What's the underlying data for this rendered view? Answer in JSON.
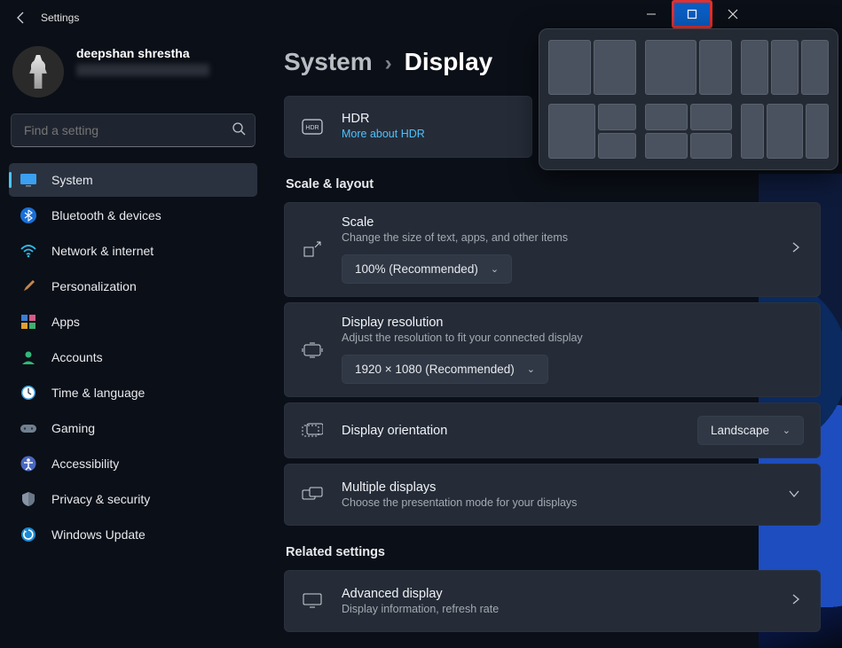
{
  "titlebar": {
    "app_title": "Settings"
  },
  "profile": {
    "name": "deepshan shrestha"
  },
  "search": {
    "placeholder": "Find a setting"
  },
  "nav": {
    "items": [
      {
        "label": "System",
        "icon": "system"
      },
      {
        "label": "Bluetooth & devices",
        "icon": "bluetooth"
      },
      {
        "label": "Network & internet",
        "icon": "wifi"
      },
      {
        "label": "Personalization",
        "icon": "brush"
      },
      {
        "label": "Apps",
        "icon": "apps"
      },
      {
        "label": "Accounts",
        "icon": "person"
      },
      {
        "label": "Time & language",
        "icon": "clock"
      },
      {
        "label": "Gaming",
        "icon": "gamepad"
      },
      {
        "label": "Accessibility",
        "icon": "accessibility"
      },
      {
        "label": "Privacy & security",
        "icon": "shield"
      },
      {
        "label": "Windows Update",
        "icon": "update"
      }
    ]
  },
  "breadcrumb": {
    "root": "System",
    "current": "Display"
  },
  "hdr": {
    "title": "HDR",
    "link": "More about HDR"
  },
  "sections": {
    "scale_layout": "Scale & layout",
    "related": "Related settings"
  },
  "scale": {
    "title": "Scale",
    "sub": "Change the size of text, apps, and other items",
    "value": "100% (Recommended)"
  },
  "resolution": {
    "title": "Display resolution",
    "sub": "Adjust the resolution to fit your connected display",
    "value": "1920 × 1080 (Recommended)"
  },
  "orientation": {
    "title": "Display orientation",
    "value": "Landscape"
  },
  "multiple": {
    "title": "Multiple displays",
    "sub": "Choose the presentation mode for your displays"
  },
  "advanced": {
    "title": "Advanced display",
    "sub": "Display information, refresh rate"
  }
}
